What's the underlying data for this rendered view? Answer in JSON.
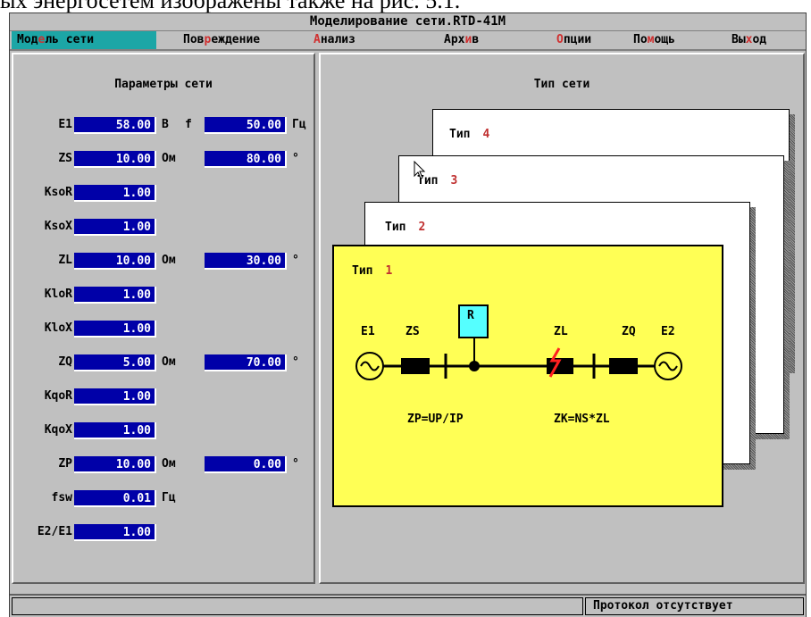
{
  "document_text": "ых энергосетем изображены также на рис. 5.1.",
  "window": {
    "title": "Моделирование сети.RTD-41M"
  },
  "menu": [
    {
      "pre": "Мод",
      "hot": "е",
      "post": "ль сети",
      "active": true
    },
    {
      "pre": "Пов",
      "hot": "р",
      "post": "еждение",
      "active": false
    },
    {
      "pre": "",
      "hot": "А",
      "post": "нализ",
      "active": false
    },
    {
      "pre": "Арх",
      "hot": "и",
      "post": "в",
      "active": false
    },
    {
      "pre": "",
      "hot": "О",
      "post": "пции",
      "active": false
    },
    {
      "pre": "По",
      "hot": "м",
      "post": "ощь",
      "active": false
    },
    {
      "pre": "Вы",
      "hot": "х",
      "post": "од",
      "active": false
    }
  ],
  "params": {
    "title": "Параметры сети",
    "rows": [
      {
        "label": "E1",
        "value": "58.00",
        "unit": "В",
        "label2": "f",
        "value2": "50.00",
        "unit2": "Гц"
      },
      {
        "label": "ZS",
        "value": "10.00",
        "unit": "Ом",
        "value2": "80.00",
        "unit2": "°"
      },
      {
        "label": "KsoR",
        "value": "1.00"
      },
      {
        "label": "KsoX",
        "value": "1.00"
      },
      {
        "label": "ZL",
        "value": "10.00",
        "unit": "Ом",
        "value2": "30.00",
        "unit2": "°"
      },
      {
        "label": "KloR",
        "value": "1.00"
      },
      {
        "label": "KloX",
        "value": "1.00"
      },
      {
        "label": "ZQ",
        "value": "5.00",
        "unit": "Ом",
        "value2": "70.00",
        "unit2": "°"
      },
      {
        "label": "KqoR",
        "value": "1.00"
      },
      {
        "label": "KqoX",
        "value": "1.00"
      },
      {
        "label": "ZP",
        "value": "10.00",
        "unit": "Ом",
        "value2": "0.00",
        "unit2": "°"
      },
      {
        "label": "fsw",
        "value": "0.01",
        "unit": "Гц"
      },
      {
        "label": "E2/E1",
        "value": "1.00"
      }
    ]
  },
  "network_type": {
    "title": "Тип сети",
    "cards": [
      {
        "label": "Тип",
        "num": "4"
      },
      {
        "label": "Тип",
        "num": "3"
      },
      {
        "label": "Тип",
        "num": "2"
      },
      {
        "label": "Тип",
        "num": "1"
      }
    ],
    "diagram": {
      "e1": "E1",
      "zs": "ZS",
      "r": "R",
      "zl": "ZL",
      "zq": "ZQ",
      "e2": "E2",
      "formula1": "ZP=UP/IP",
      "formula2": "ZK=NS*ZL"
    }
  },
  "status": {
    "message": "Протокол отсутствует"
  },
  "colors": {
    "field_bg": "#0000a8",
    "active_menu": "#1ca6a6",
    "diagram_bg": "#ffff55",
    "relay_box": "#55ffff"
  }
}
